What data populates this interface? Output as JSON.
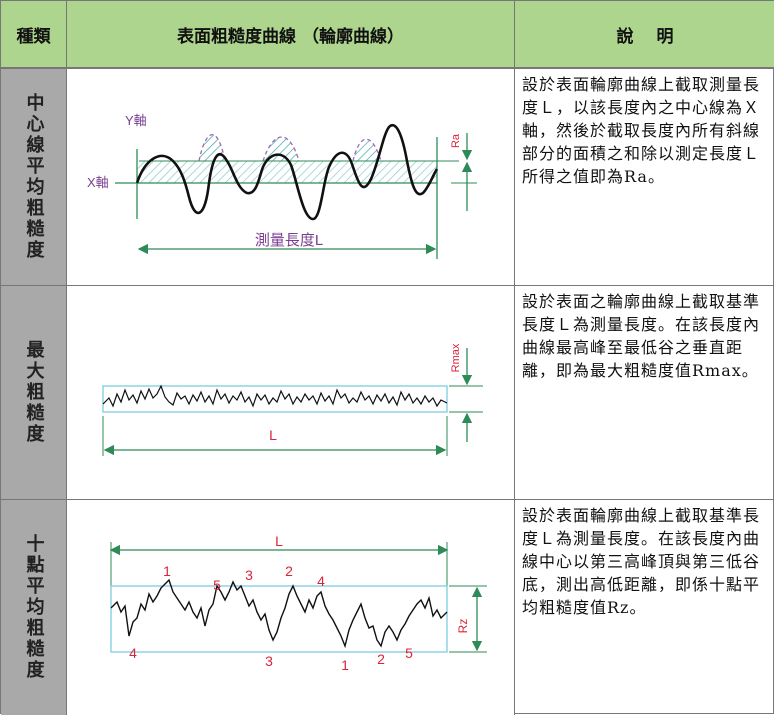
{
  "headers": {
    "type": "種類",
    "curve": "表面粗糙度曲線 （輪廓曲線）",
    "desc": "說　 明"
  },
  "rows": [
    {
      "category": "中心線平均粗糙度",
      "description": "設於表面輪廓曲線上截取測量長度Ｌ，以該長度內之中心線為Ｘ軸，然後於截取長度內所有斜線部分的面積之和除以測定長度Ｌ所得之值即為Ra。",
      "labels": {
        "y_axis": "Y軸",
        "x_axis": "X軸",
        "measure": "測量長度L",
        "ra": "Ra"
      }
    },
    {
      "category": "最大粗糙度",
      "description": "設於表面之輪廓曲線上截取基準長度Ｌ為測量長度。在該長度內曲線最高峰至最低谷之垂直距離，即為最大粗糙度值Rmax。",
      "labels": {
        "rmax": "Rmax",
        "l": "L"
      }
    },
    {
      "category": "十點平均粗糙度",
      "description": "設於表面輪廓曲線上截取基準長度Ｌ為測量長度。在該長度內曲線中心以第三高峰頂與第三低谷底，測出高低距離，即係十點平均粗糙度值Rz。",
      "labels": {
        "l": "L",
        "rz": "Rz",
        "peaks": [
          "1",
          "5",
          "3",
          "2",
          "4"
        ],
        "valleys": [
          "4",
          "3",
          "1",
          "2",
          "5"
        ]
      }
    }
  ],
  "colors": {
    "header_bg": "#aed58d",
    "category_bg": "#a9a9a9",
    "hatch": "#7ec6c6",
    "green": "#2e8b57",
    "red": "#d9253a",
    "box": "#7ecde0"
  }
}
